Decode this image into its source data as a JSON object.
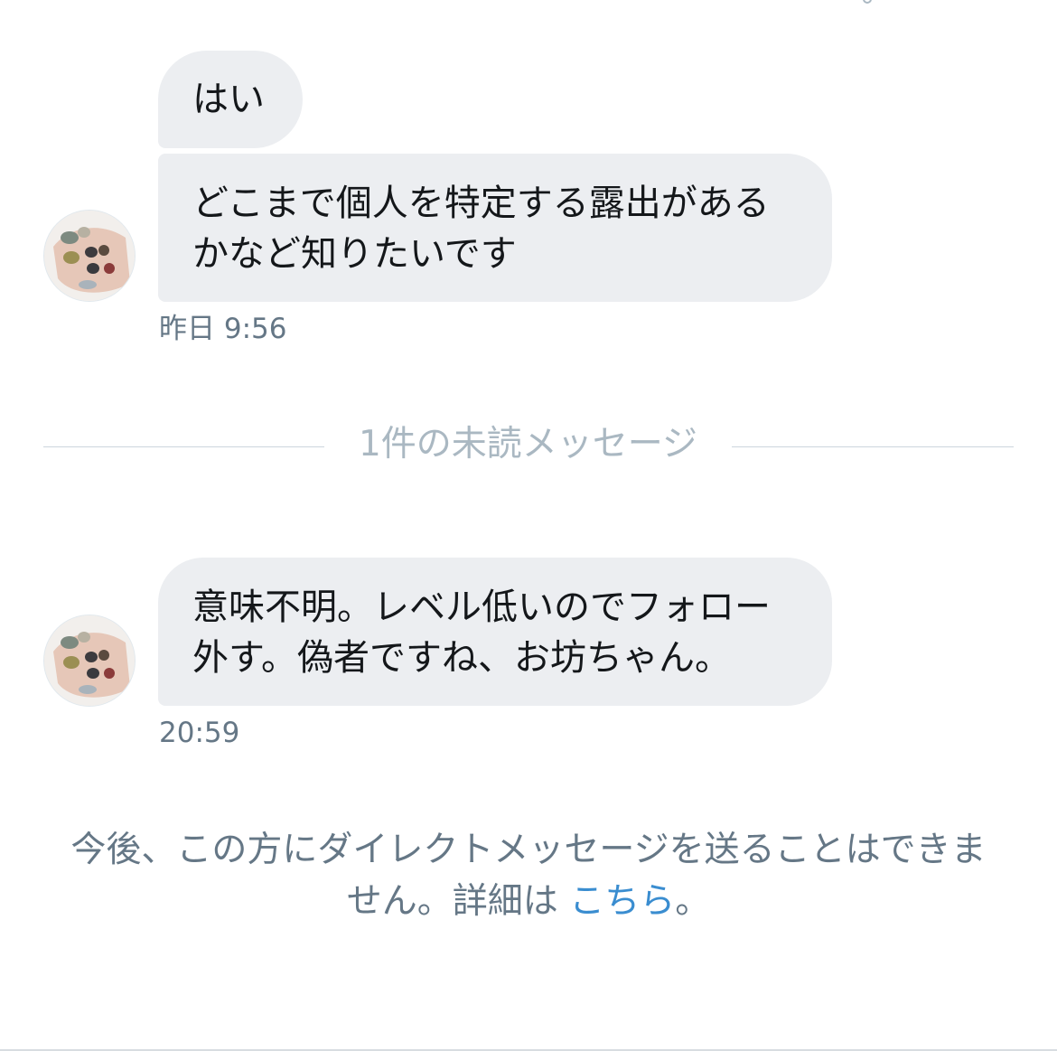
{
  "messages": [
    {
      "text": "はい"
    },
    {
      "line1": "どこまで個人を特定する露出がある",
      "line2": "かなど知りたいです",
      "time": "昨日 9:56"
    },
    {
      "line1": "意味不明。レベル低いのでフォロー",
      "line2": "外す。偽者ですね、お坊ちゃん。",
      "time": "20:59"
    }
  ],
  "unread_divider": "1件の未読メッセージ",
  "notice": {
    "line1": "今後、この方にダイレクトメッセージを送ることはできま",
    "line2": "せん。詳細は",
    "link": "こちら",
    "end": "。"
  },
  "colors": {
    "bubble": "#eceef1",
    "timestamp": "#657786",
    "divider_text": "#aab8c2",
    "link": "#3a8dd0"
  },
  "icons": {
    "avatar": "user-avatar-nails-photo"
  }
}
